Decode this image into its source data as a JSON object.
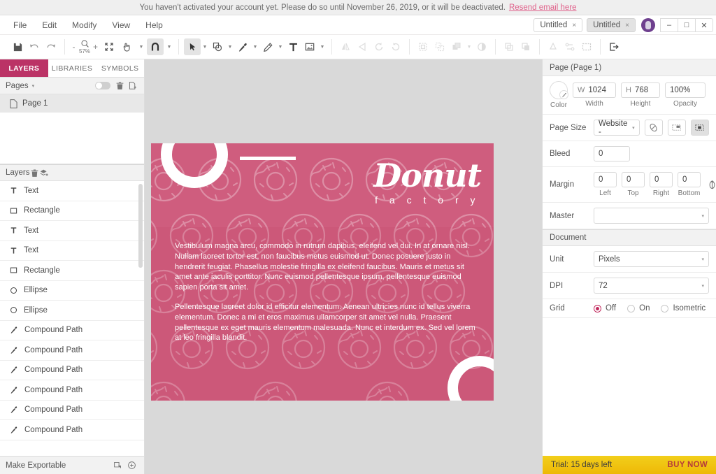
{
  "banner": {
    "message": "You haven't activated your account yet. Please do so until November 26, 2019, or it will be deactivated.",
    "link": "Resend email here"
  },
  "menubar": {
    "items": [
      "File",
      "Edit",
      "Modify",
      "View",
      "Help"
    ],
    "tabs": [
      {
        "label": "Untitled",
        "close": "×",
        "active": false
      },
      {
        "label": "Untitled",
        "close": "×",
        "active": true
      }
    ],
    "window_controls": {
      "minimize": "–",
      "maximize": "□",
      "close": "✕"
    }
  },
  "toolbar": {
    "zoom_value": "57%",
    "zoom_minus": "-",
    "zoom_plus": "+",
    "items": [
      "save-icon",
      "undo-icon",
      "redo-icon",
      "zoom-icon",
      "fit-icon",
      "hand-icon",
      "magnet-icon",
      "pointer-icon",
      "shape-icon",
      "pen-icon",
      "pencil-icon",
      "text-icon",
      "image-icon",
      "flip-horizontal-icon",
      "flip-vertical-icon",
      "rotate-ccw-icon",
      "rotate-cw-icon",
      "group-icon",
      "ungroup-icon",
      "arrange-icon",
      "mask-icon",
      "boolean-union-icon",
      "boolean-subtract-icon",
      "recycle-icon",
      "path-icon",
      "marquee-icon",
      "export-icon"
    ]
  },
  "left_panel": {
    "tabs": [
      {
        "label": "LAYERS",
        "active": true
      },
      {
        "label": "LIBRARIES",
        "active": false
      },
      {
        "label": "SYMBOLS",
        "active": false
      }
    ],
    "pages_header": {
      "title": "Pages",
      "caret": "▾",
      "icons": [
        "toggle-switch",
        "trash-icon",
        "add-page-icon"
      ]
    },
    "pages": [
      {
        "label": "Page 1",
        "icon": "page-icon",
        "selected": true
      }
    ],
    "layers_header": {
      "title": "Layers",
      "icons": [
        "trash-icon",
        "add-layer-icon"
      ]
    },
    "layers": [
      {
        "label": "Text",
        "icon": "text-icon"
      },
      {
        "label": "Rectangle",
        "icon": "rectangle-icon"
      },
      {
        "label": "Text",
        "icon": "text-icon"
      },
      {
        "label": "Text",
        "icon": "text-icon"
      },
      {
        "label": "Rectangle",
        "icon": "rectangle-icon"
      },
      {
        "label": "Ellipse",
        "icon": "ellipse-icon"
      },
      {
        "label": "Ellipse",
        "icon": "ellipse-icon"
      },
      {
        "label": "Compound Path",
        "icon": "pen-icon"
      },
      {
        "label": "Compound Path",
        "icon": "pen-icon"
      },
      {
        "label": "Compound Path",
        "icon": "pen-icon"
      },
      {
        "label": "Compound Path",
        "icon": "pen-icon"
      },
      {
        "label": "Compound Path",
        "icon": "pen-icon"
      },
      {
        "label": "Compound Path",
        "icon": "pen-icon"
      }
    ],
    "make_exportable": {
      "label": "Make Exportable",
      "icons": [
        "export-slice-icon",
        "plus-circle-icon"
      ]
    }
  },
  "canvas": {
    "artboard": {
      "brand_name": "Donut",
      "brand_sub": "f a c t o r y",
      "background_color": "#cf5d7e",
      "paragraphs": [
        "Vestibulum magna arcu, commodo in rutrum dapibus, eleifend vel dui. In at ornare nisl. Nullam laoreet tortor est, non faucibus metus euismod ut. Donec posuere justo in hendrerit feugiat. Phasellus molestie fringilla ex eleifend faucibus. Mauris et metus sit amet ante iaculis porttitor. Nunc euismod pellentesque ipsum, pellentesque euismod sapien porta sit amet.",
        "Pellentesque laoreet dolor id efficitur elementum. Aenean ultricies nunc id tellus viverra elementum. Donec a mi et eros maximus ullamcorper sit amet vel nulla. Praesent pellentesque ex eget mauris elementum malesuada. Nunc et interdum ex. Sed vel lorem at leo fringilla blandit."
      ]
    }
  },
  "right_panel": {
    "title": "Page (Page 1)",
    "color": {
      "caption": "Color"
    },
    "width": {
      "prefix": "W",
      "value": "1024",
      "caption": "Width"
    },
    "height": {
      "prefix": "H",
      "value": "768",
      "caption": "Height"
    },
    "opacity": {
      "value": "100%",
      "caption": "Opacity"
    },
    "page_size": {
      "label": "Page Size",
      "value": "Website -",
      "caret": "▾"
    },
    "bleed": {
      "label": "Bleed",
      "value": "0"
    },
    "margin": {
      "label": "Margin",
      "values": [
        "0",
        "0",
        "0",
        "0"
      ],
      "captions": [
        "Left",
        "Top",
        "Right",
        "Bottom"
      ]
    },
    "master": {
      "label": "Master",
      "value": "",
      "caret": "▾"
    },
    "document_header": "Document",
    "unit": {
      "label": "Unit",
      "value": "Pixels",
      "caret": "▾"
    },
    "dpi": {
      "label": "DPI",
      "value": "72",
      "caret": "▾"
    },
    "grid": {
      "label": "Grid",
      "options": [
        {
          "label": "Off",
          "selected": true
        },
        {
          "label": "On",
          "selected": false
        },
        {
          "label": "Isometric",
          "selected": false
        }
      ]
    },
    "trial": {
      "text": "Trial: 15 days left",
      "buy": "BUY NOW"
    }
  }
}
